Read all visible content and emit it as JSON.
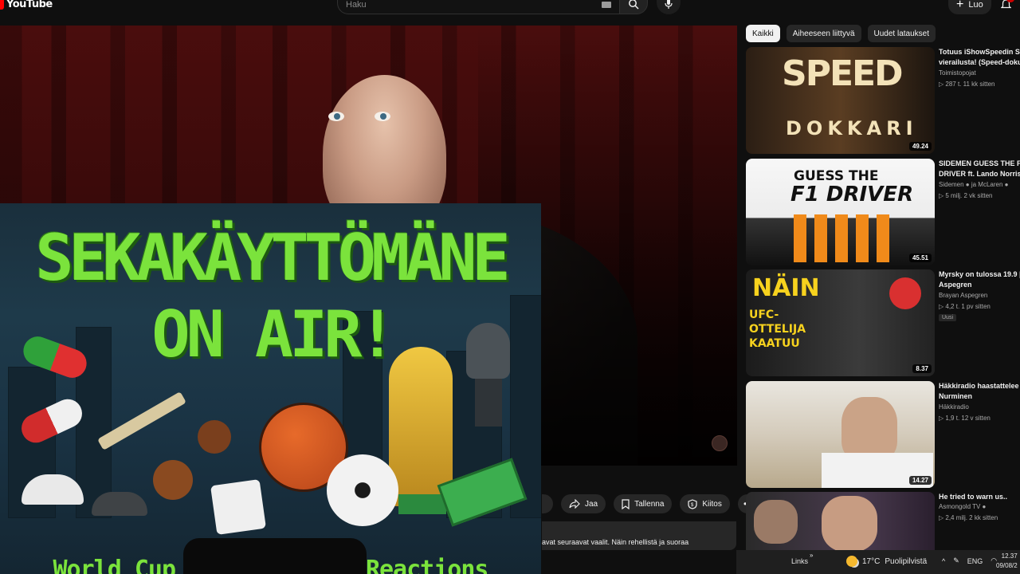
{
  "app": {
    "logo_text": "YouTube",
    "create_label": "Luo",
    "notifications_count": "2"
  },
  "search": {
    "placeholder": "Haku"
  },
  "actions": {
    "share": "Jaa",
    "save": "Tallenna",
    "thanks": "Kiitos"
  },
  "description_snippet": "avat seuraavat vaalit. Näin rehellistä ja suoraa",
  "overlay": {
    "line1": "SEKAKÄYTTÖMÄNE",
    "line2": "ON AIR!",
    "bottom_left": "World Cup R",
    "bottom_right": "Reactions"
  },
  "chips": [
    {
      "label": "Kaikki",
      "active": true
    },
    {
      "label": "Aiheeseen liittyvä",
      "active": false
    },
    {
      "label": "Uudet lataukset",
      "active": false
    }
  ],
  "recommendations": [
    {
      "title1": "Totuus iShowSpeedin Su",
      "title2": "vierailusta! (Speed-doku",
      "channel": "Toimistopojat",
      "meta": "▷ 287 t.  11 kk sitten",
      "duration": "49.24",
      "thumb_text1": "SPEED",
      "thumb_text2": "DOKKARI",
      "badge": "",
      "verified": false
    },
    {
      "title1": "SIDEMEN GUESS THE F1",
      "title2": "DRIVER ft. Lando Norris",
      "channel": "Sidemen ● ja McLaren ●",
      "meta": "▷ 5 milj.  2 vk sitten",
      "duration": "45.51",
      "thumb_text1": "GUESS THE",
      "thumb_text2": "F1 DRIVER",
      "badge": "",
      "verified": true
    },
    {
      "title1": "Myrsky on tulossa 19.9 |",
      "title2": "Aspegren",
      "channel": "Brayan Aspegren",
      "meta": "▷ 4,2 t.  1 pv sitten",
      "duration": "8.37",
      "thumb_text1": "NÄIN",
      "thumb_text2": "UFC-OTTELIJA KAATUU",
      "badge": "Uusi",
      "verified": false
    },
    {
      "title1": "Häkkiradio haastattelee",
      "title2": "Nurminen",
      "channel": "Häkkiradio",
      "meta": "▷ 1,9 t.  12 v sitten",
      "duration": "14.27",
      "thumb_text1": "",
      "thumb_text2": "",
      "badge": "",
      "verified": false
    },
    {
      "title1": "He tried to warn us..",
      "title2": "",
      "channel": "Asmongold TV ●",
      "meta": "▷ 2,4 milj.  2 kk sitten",
      "duration": "",
      "thumb_text1": "",
      "thumb_text2": "",
      "badge": "",
      "verified": true
    }
  ],
  "taskbar": {
    "links": "Links",
    "temp": "17°C",
    "weather": "Puolipilvistä",
    "lang": "ENG",
    "time": "12.37",
    "date": "09/08/2"
  },
  "colors": {
    "accent_red": "#ff0000",
    "overlay_green": "#7be33c",
    "bg": "#0f0f0f",
    "chip_bg": "#272727"
  }
}
